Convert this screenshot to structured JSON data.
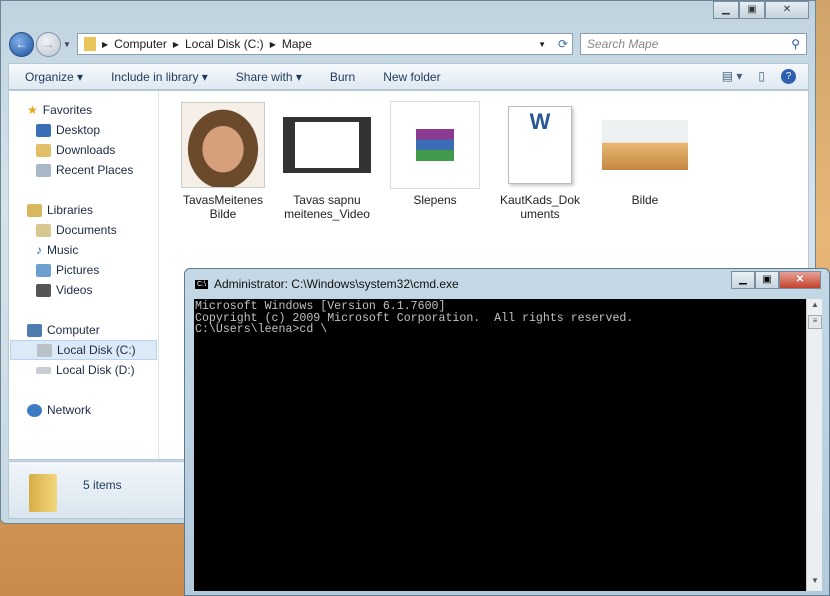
{
  "explorer": {
    "breadcrumb": [
      "Computer",
      "Local Disk (C:)",
      "Mape"
    ],
    "search_placeholder": "Search Mape",
    "toolbar": {
      "organize": "Organize ▾",
      "include": "Include in library ▾",
      "share": "Share with ▾",
      "burn": "Burn",
      "new_folder": "New folder"
    },
    "nav": {
      "favorites": "Favorites",
      "desktop": "Desktop",
      "downloads": "Downloads",
      "recent": "Recent Places",
      "libraries": "Libraries",
      "documents": "Documents",
      "music": "Music",
      "pictures": "Pictures",
      "videos": "Videos",
      "computer": "Computer",
      "local_c": "Local Disk (C:)",
      "local_d": "Local Disk (D:)",
      "network": "Network"
    },
    "files": [
      {
        "name": "TavasMeitenesBilde",
        "icon": "photo-face"
      },
      {
        "name": "Tavas sapnu meitenes_Video",
        "icon": "video-file"
      },
      {
        "name": "Slepens",
        "icon": "winrar-archive"
      },
      {
        "name": "KautKads_Dokuments",
        "icon": "word-document"
      },
      {
        "name": "Bilde",
        "icon": "desert-photo"
      }
    ],
    "status": "5 items"
  },
  "cmd": {
    "title": "Administrator: C:\\Windows\\system32\\cmd.exe",
    "lines": [
      "Microsoft Windows [Version 6.1.7600]",
      "Copyright (c) 2009 Microsoft Corporation.  All rights reserved.",
      "",
      "C:\\Users\\leena>cd \\"
    ]
  }
}
